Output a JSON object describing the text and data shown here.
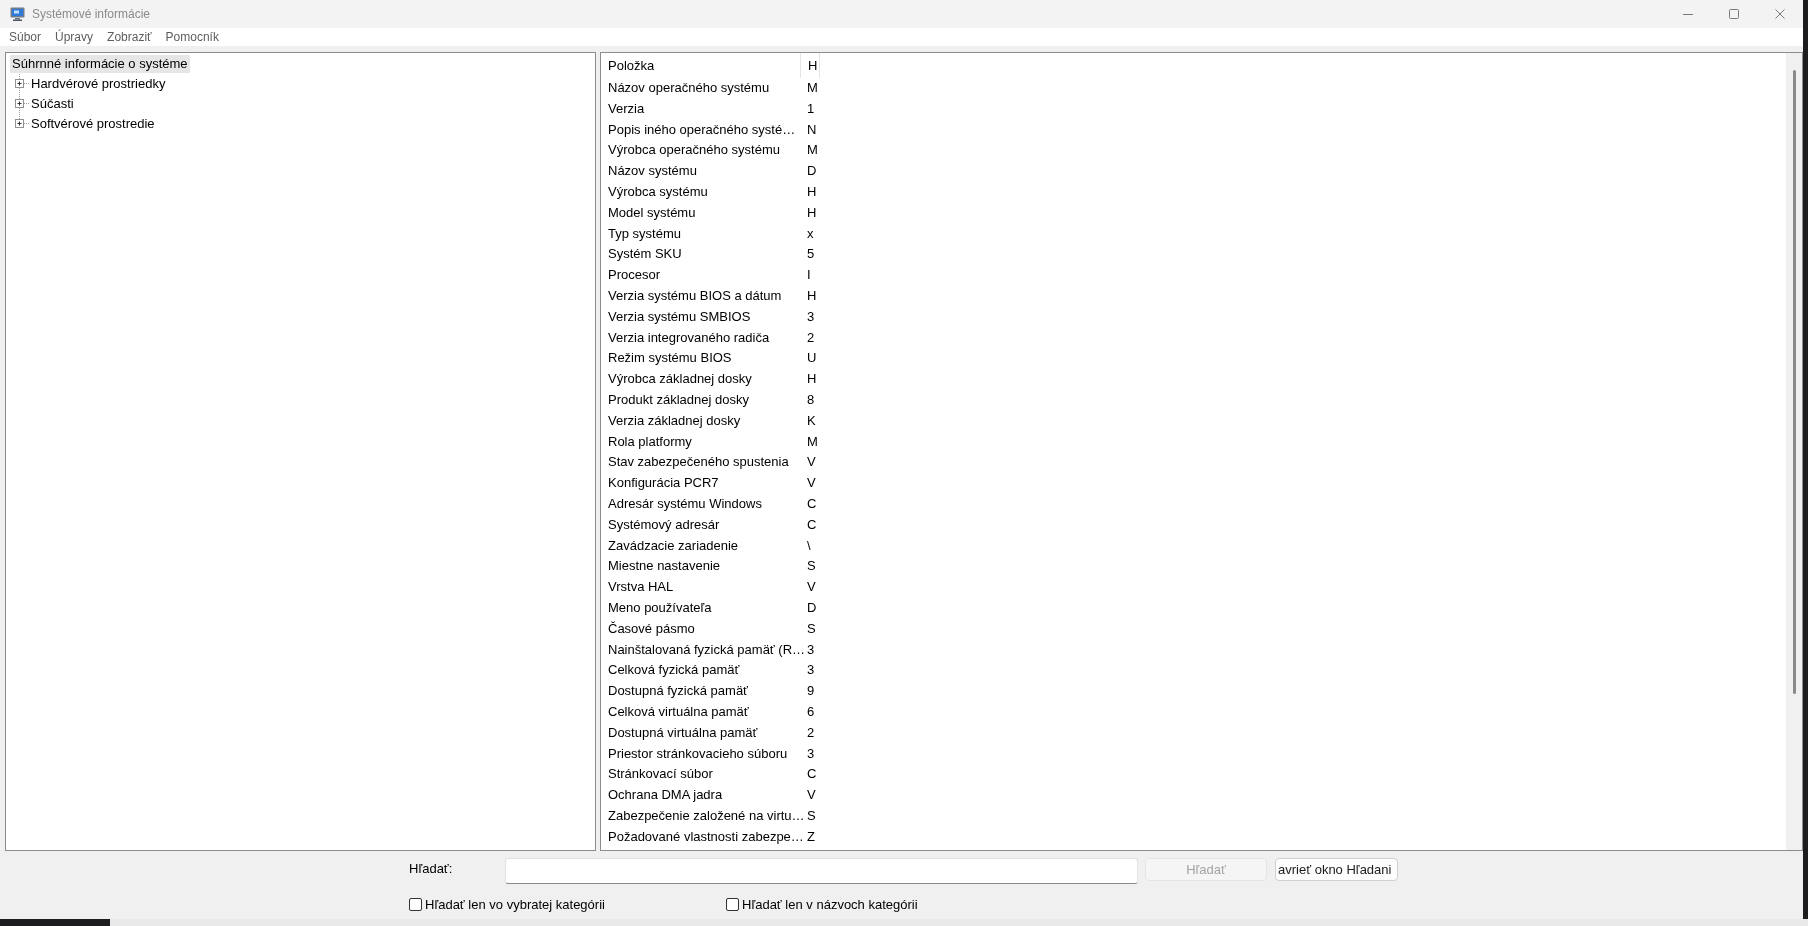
{
  "window": {
    "title": "Systémové informácie"
  },
  "menu": [
    "Súbor",
    "Úpravy",
    "Zobraziť",
    "Pomocník"
  ],
  "tree": {
    "items": [
      {
        "label": "Súhrnné informácie o systéme",
        "selected": true,
        "children": [
          {
            "label": "Hardvérové prostriedky",
            "expanded": false,
            "selected": false
          },
          {
            "label": "Súčasti",
            "expanded": false,
            "selected": false
          },
          {
            "label": "Softvérové prostredie",
            "expanded": false,
            "selected": false
          }
        ]
      }
    ]
  },
  "table": {
    "columns": [
      "Položka",
      "H"
    ],
    "rows": [
      [
        "Názov operačného systému",
        "M"
      ],
      [
        "Verzia",
        "1"
      ],
      [
        "Popis iného operačného systé…",
        "N"
      ],
      [
        "Výrobca operačného systému",
        "M"
      ],
      [
        "Názov systému",
        "D"
      ],
      [
        "Výrobca systému",
        "H"
      ],
      [
        "Model systému",
        "H"
      ],
      [
        "Typ systému",
        "x"
      ],
      [
        "Systém SKU",
        "5"
      ],
      [
        "Procesor",
        "I"
      ],
      [
        "Verzia systému BIOS a dátum",
        "H"
      ],
      [
        "Verzia systému SMBIOS",
        "3"
      ],
      [
        "Verzia integrovaného radiča",
        "2"
      ],
      [
        "Režim systému BIOS",
        "U"
      ],
      [
        "Výrobca základnej dosky",
        "H"
      ],
      [
        "Produkt základnej dosky",
        "8"
      ],
      [
        "Verzia základnej dosky",
        "K"
      ],
      [
        "Rola platformy",
        "M"
      ],
      [
        "Stav zabezpečeného spustenia",
        "V"
      ],
      [
        "Konfigurácia PCR7",
        "V"
      ],
      [
        "Adresár systému Windows",
        "C"
      ],
      [
        "Systémový adresár",
        "C"
      ],
      [
        "Zavádzacie zariadenie",
        "\\"
      ],
      [
        "Miestne nastavenie",
        "S"
      ],
      [
        "Vrstva HAL",
        "V"
      ],
      [
        "Meno používateľa",
        "D"
      ],
      [
        "Časové pásmo",
        "S"
      ],
      [
        "Nainštalovaná fyzická pamäť (R…",
        "3"
      ],
      [
        "Celková fyzická pamäť",
        "3"
      ],
      [
        "Dostupná fyzická pamäť",
        "9"
      ],
      [
        "Celková virtuálna pamäť",
        "6"
      ],
      [
        "Dostupná virtuálna pamäť",
        "2"
      ],
      [
        "Priestor stránkovacieho súboru",
        "3"
      ],
      [
        "Stránkovací súbor",
        "C"
      ],
      [
        "Ochrana DMA jadra",
        "V"
      ],
      [
        "Zabezpečenie založené na virtu…",
        "S"
      ],
      [
        "Požadované vlastnosti zabezpe…",
        "Z"
      ]
    ]
  },
  "search": {
    "label": "Hľadať:",
    "find_button": {
      "label": "Hľadať",
      "disabled": true
    },
    "close_button": {
      "label": "avrieť okno Hľadani"
    },
    "options": [
      {
        "label": "Hľadať len vo vybratej kategórii",
        "checked": false
      },
      {
        "label": "Hľadať len v názvoch kategórii",
        "checked": false
      }
    ]
  }
}
